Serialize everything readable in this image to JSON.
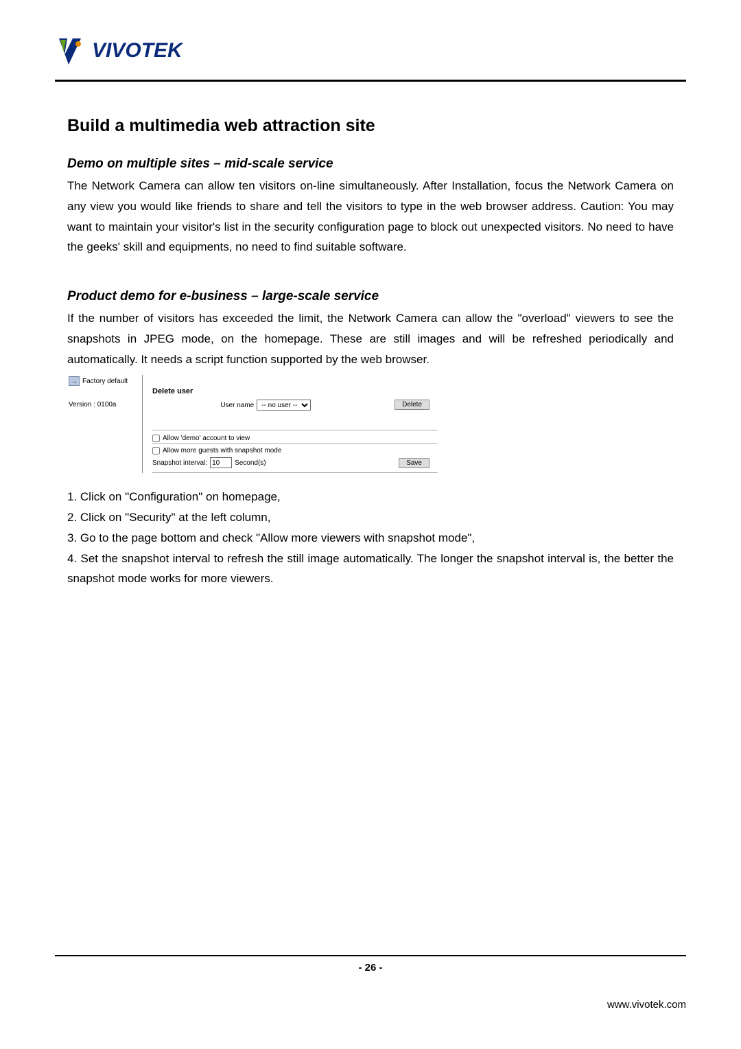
{
  "logo": {
    "text": "VIVOTEK"
  },
  "headings": {
    "main": "Build a multimedia web attraction site",
    "demo": "Demo on multiple sites – mid-scale service",
    "product": "Product demo for e-business – large-scale service"
  },
  "paragraphs": {
    "demo": "The Network Camera can allow ten visitors on-line simultaneously. After Installation, focus the Network Camera on any view you would like friends to share and tell the visitors to type in the web browser address. Caution:   You may want to maintain your visitor's list in the security configuration page to block out unexpected visitors. No need to have the geeks' skill and equipments, no need to find suitable software.",
    "product": "If the number of visitors has exceeded the limit, the Network Camera can allow the \"overload\" viewers to see the snapshots in JPEG mode, on the homepage.   These are still images and will be refreshed periodically and automatically.  It needs a script function supported by the web browser."
  },
  "config": {
    "factory_default": "Factory default",
    "version": "Version : 0100a",
    "delete_user_label": "Delete user",
    "username_label": "User name",
    "username_selected": "-- no user --",
    "delete_btn": "Delete",
    "allow_demo": "Allow 'demo' account to view",
    "allow_more_guests": "Allow more guests with snapshot mode",
    "snapshot_interval_label": "Snapshot interval:",
    "snapshot_interval_value": "10",
    "seconds_label": "Second(s)",
    "save_btn": "Save"
  },
  "steps": {
    "s1": "1. Click on \"Configuration\" on homepage,",
    "s2": "2. Click on \"Security\" at the left column,",
    "s3": "3. Go to the page bottom and check \"Allow more viewers with snapshot mode\",",
    "s4": "4. Set the snapshot interval to refresh the still image automatically. The longer the snapshot interval is, the better the snapshot mode works for more viewers."
  },
  "footer": {
    "page": "- 26 -",
    "url": "www.vivotek.com"
  }
}
